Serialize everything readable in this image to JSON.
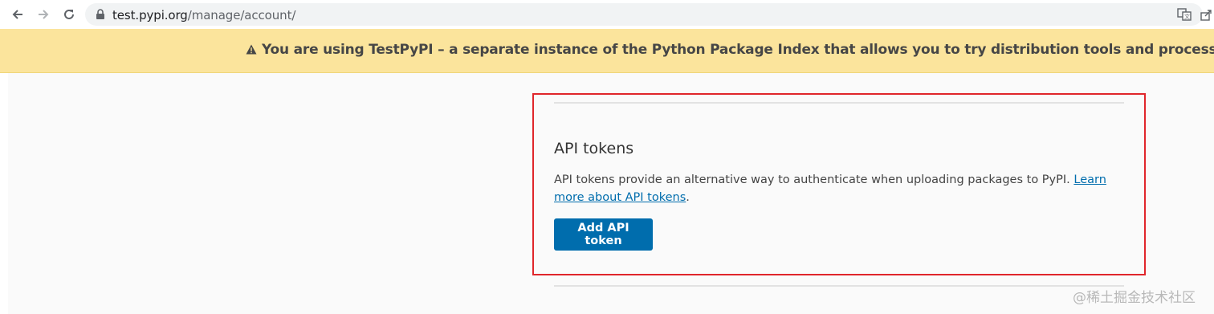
{
  "browser": {
    "url_host": "test.pypi.org",
    "url_path": "/manage/account/",
    "icons": [
      "back-arrow-icon",
      "forward-arrow-icon",
      "reload-icon",
      "lock-icon",
      "translate-icon",
      "share-icon"
    ]
  },
  "banner": {
    "icon": "warning-icon",
    "text": "You are using TestPyPI – a separate instance of the Python Package Index that allows you to try distribution tools and processes without affecting the real index.",
    "color": "#fbe49c"
  },
  "section": {
    "title": "API tokens",
    "description": "API tokens provide an alternative way to authenticate when uploading packages to PyPI.",
    "learn_more_link": "Learn more about API tokens",
    "trailing": ".",
    "button_label": "Add API token",
    "button_color": "#006dad",
    "highlight_color": "#e0262b"
  },
  "watermark": "@稀土掘金技术社区"
}
